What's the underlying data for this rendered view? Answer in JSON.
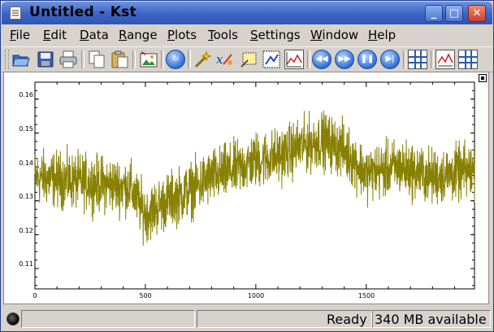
{
  "window": {
    "title": "Untitled - Kst",
    "buttons": [
      "_",
      "□",
      "✕"
    ]
  },
  "menubar": {
    "items": [
      {
        "label": "File",
        "u": "F",
        "rest": "ile"
      },
      {
        "label": "Edit",
        "u": "E",
        "rest": "dit"
      },
      {
        "label": "Data",
        "u": "D",
        "rest": "ata"
      },
      {
        "label": "Range",
        "u": "R",
        "rest": "ange"
      },
      {
        "label": "Plots",
        "u": "P",
        "rest": "lots"
      },
      {
        "label": "Tools",
        "u": "T",
        "rest": "ools"
      },
      {
        "label": "Settings",
        "u": "S",
        "rest": "ettings"
      },
      {
        "label": "Window",
        "u": "W",
        "rest": "indow"
      },
      {
        "label": "Help",
        "u": "H",
        "rest": "elp"
      }
    ]
  },
  "toolbar": {
    "icons": [
      "open-icon",
      "save-icon",
      "print-icon",
      "copy-icon",
      "paste-icon",
      "export-image-icon",
      "reload-icon",
      "data-wizard-icon",
      "equation-icon",
      "edit-multiple-icon",
      "zoom-icon",
      "layout-icon",
      "back-icon",
      "forward-icon",
      "pause-icon",
      "advance-icon",
      "data-manager-icon",
      "plot-dialog-icon",
      "change-file-icon"
    ]
  },
  "chart_data": {
    "type": "line",
    "series": [
      {
        "color": "#888000"
      }
    ],
    "xlim": [
      0,
      1990
    ],
    "ylim": [
      0.104,
      0.165
    ],
    "xticks": [
      "0",
      "500",
      "1000",
      "1500"
    ],
    "yticks": [
      "0.16",
      "0.15",
      "0.14",
      "0.13",
      "0.12",
      "0.11"
    ],
    "trend": [
      [
        0,
        0.137
      ],
      [
        150,
        0.136
      ],
      [
        300,
        0.135
      ],
      [
        430,
        0.134
      ],
      [
        500,
        0.126
      ],
      [
        600,
        0.13
      ],
      [
        700,
        0.133
      ],
      [
        800,
        0.137
      ],
      [
        900,
        0.139
      ],
      [
        1000,
        0.142
      ],
      [
        1100,
        0.143
      ],
      [
        1200,
        0.146
      ],
      [
        1300,
        0.148
      ],
      [
        1400,
        0.145
      ],
      [
        1500,
        0.138
      ],
      [
        1650,
        0.14
      ],
      [
        1800,
        0.137
      ],
      [
        1990,
        0.139
      ]
    ],
    "noise_amplitude": 0.012
  },
  "status": {
    "message": "Ready",
    "memory": "340 MB available"
  }
}
